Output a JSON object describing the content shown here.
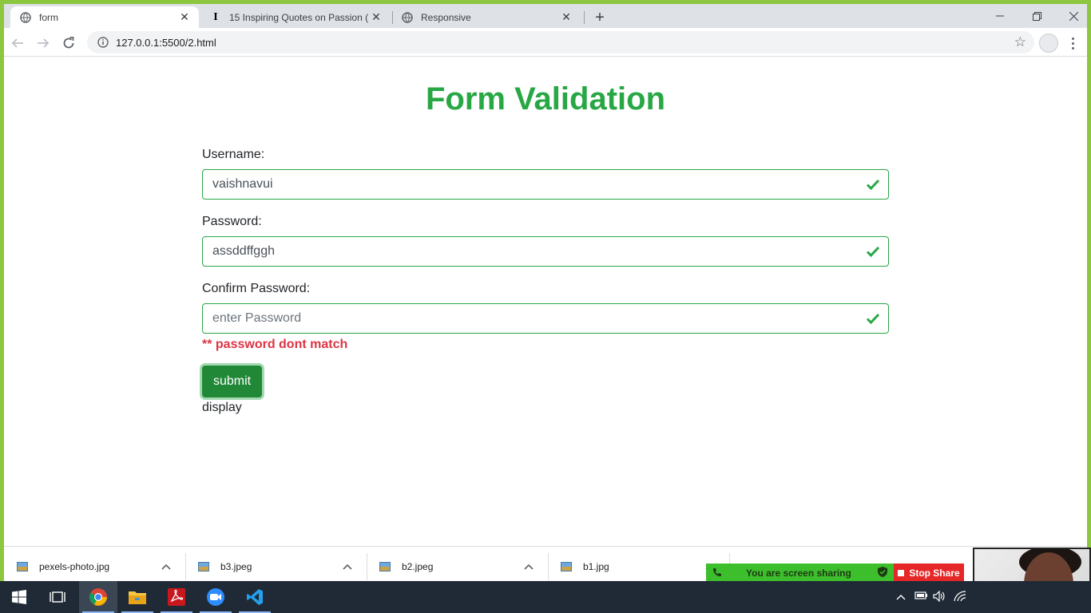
{
  "browser": {
    "tabs": [
      {
        "title": "form",
        "active": true
      },
      {
        "title": "15 Inspiring Quotes on Passion (",
        "active": false
      },
      {
        "title": "Responsive",
        "active": false
      }
    ],
    "url": "127.0.0.1:5500/2.html"
  },
  "page": {
    "heading": "Form Validation",
    "fields": [
      {
        "label": "Username:",
        "value": "vaishnavui",
        "placeholder": ""
      },
      {
        "label": "Password:",
        "value": "assddffggh",
        "placeholder": ""
      },
      {
        "label": "Confirm Password:",
        "value": "",
        "placeholder": "enter Password"
      }
    ],
    "error": "** password dont match",
    "submit_label": "submit",
    "display_text": "display"
  },
  "downloads": [
    {
      "name": "pexels-photo.jpg"
    },
    {
      "name": "b3.jpeg"
    },
    {
      "name": "b2.jpeg"
    },
    {
      "name": "b1.jpg"
    }
  ],
  "screen_share": {
    "status": "You are screen sharing",
    "stop_label": "Stop Share"
  },
  "colors": {
    "heading": "#28a745",
    "valid_border": "#28a745",
    "error": "#dc3545",
    "submit_bg": "#218838",
    "frame": "#8dc63f"
  }
}
